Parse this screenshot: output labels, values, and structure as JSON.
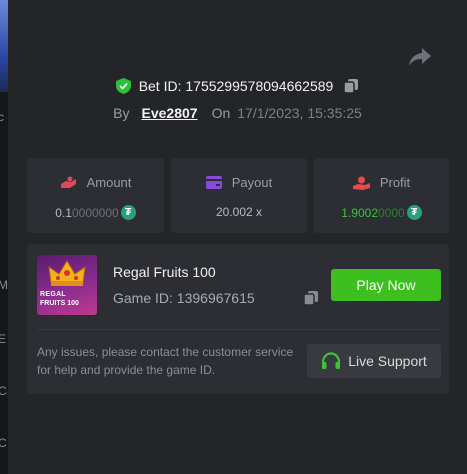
{
  "bet": {
    "id_label": "Bet ID:",
    "id_value": "1755299578094662589",
    "by_label": "By",
    "username": "Eve2807",
    "on_label": "On",
    "timestamp": "17/1/2023, 15:35:25"
  },
  "stats": {
    "amount": {
      "label": "Amount",
      "value_main": "0.1",
      "value_dim": "0000000",
      "currency_icon": "tether-icon"
    },
    "payout": {
      "label": "Payout",
      "value": "20.002 x"
    },
    "profit": {
      "label": "Profit",
      "value_main": "1.9002",
      "value_dim": "0000",
      "currency_icon": "tether-icon"
    }
  },
  "game": {
    "title": "Regal Fruits 100",
    "id_text": "Game ID: 1396967615",
    "thumb_line1": "REGAL",
    "thumb_line2": "FRUITS 100",
    "play_label": "Play Now"
  },
  "support": {
    "message": "Any issues, please contact the customer service for help and provide the game ID.",
    "button_label": "Live Support"
  },
  "colors": {
    "accent_green": "#3cbf1f",
    "profit_green": "#3ec13c",
    "verified_green": "#2bbf3a",
    "amount_icon": "#e0475f",
    "payout_icon": "#8a4ad8",
    "profit_icon": "#e84a4a"
  },
  "backdrop": {
    "marks": [
      "c",
      "M",
      "E",
      "C",
      "C"
    ]
  }
}
